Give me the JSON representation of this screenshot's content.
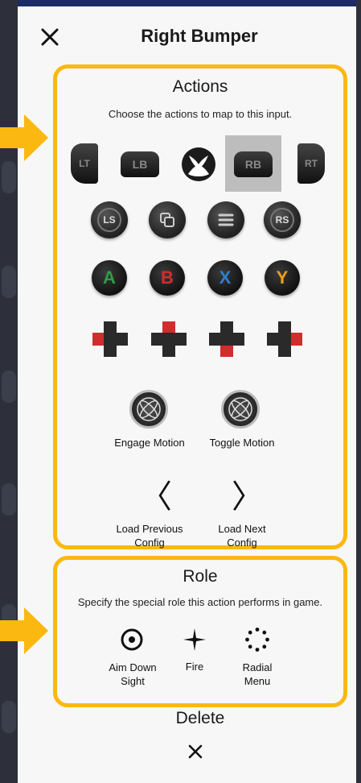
{
  "header": {
    "title": "Right Bumper"
  },
  "actions": {
    "title": "Actions",
    "subtitle": "Choose the actions to map to this input.",
    "row1": [
      "LT",
      "LB",
      "RB",
      "RT"
    ],
    "row2": [
      "LS",
      "RS"
    ],
    "faces": [
      "A",
      "B",
      "X",
      "Y"
    ],
    "engage_motion": "Engage Motion",
    "toggle_motion": "Toggle Motion",
    "load_previous": "Load Previous Config",
    "load_next": "Load Next Config"
  },
  "role": {
    "title": "Role",
    "subtitle": "Specify the special role this action performs in game.",
    "items": [
      "Aim Down Sight",
      "Fire",
      "Radial Menu"
    ]
  },
  "delete": {
    "label": "Delete"
  },
  "colors": {
    "highlight": "#fbb811",
    "face_a": "#2e9e45",
    "face_b": "#d32c2c",
    "face_x": "#2b7fd1",
    "face_y": "#e8a21a",
    "selected": "#bdbdbd"
  },
  "icons": {
    "close": "close-icon",
    "xbox": "xbox-logo-icon",
    "view": "view-button-icon",
    "menu": "menu-button-icon",
    "dpad": "dpad-icon",
    "motion": "gyro-motion-icon",
    "previous": "chevron-left-icon",
    "next": "chevron-right-icon",
    "aim": "target-icon",
    "fire": "crosshair-star-icon",
    "radial": "radial-menu-icon",
    "delete": "close-icon"
  }
}
